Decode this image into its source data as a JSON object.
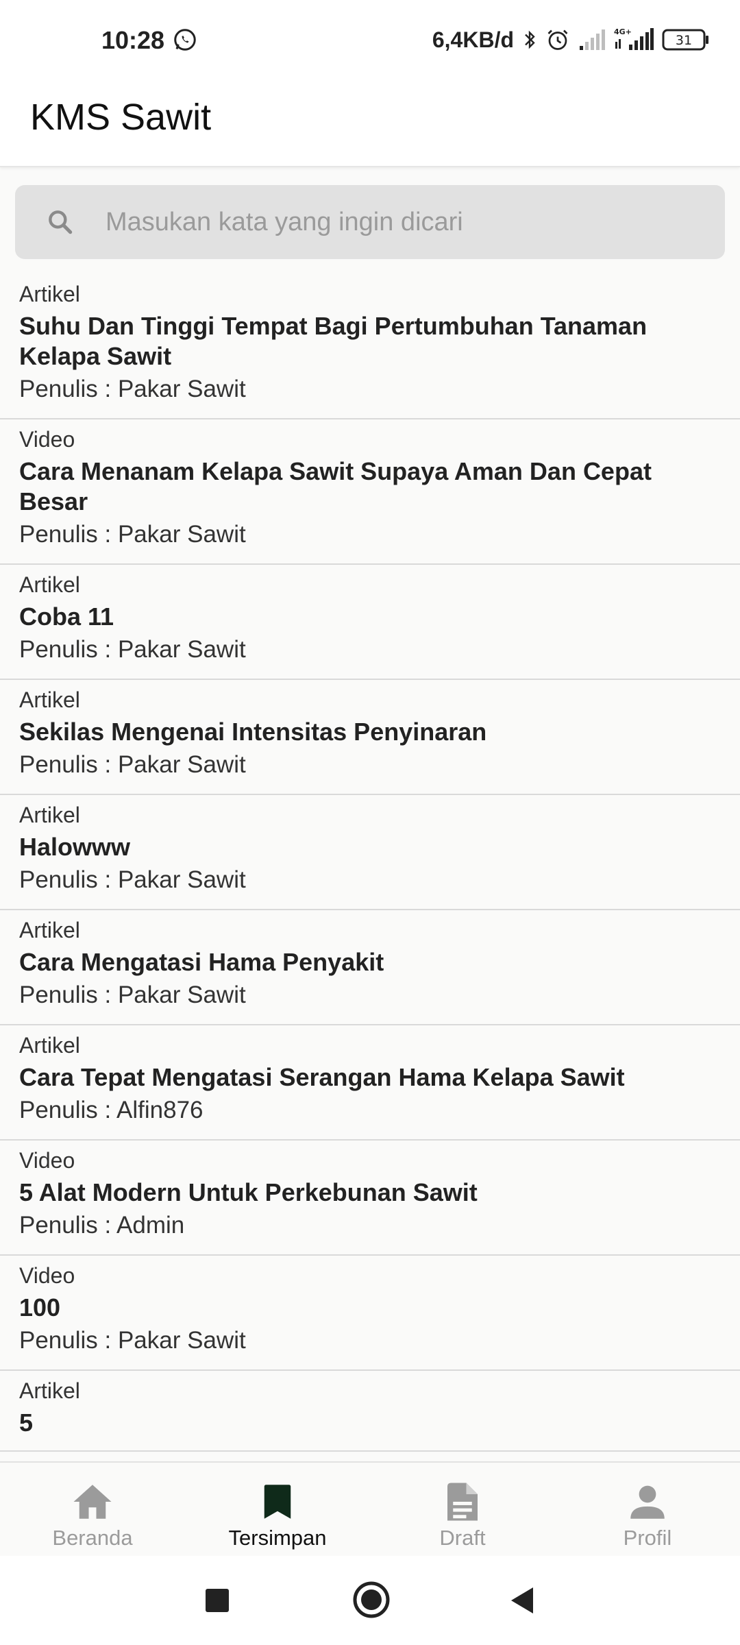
{
  "status_bar": {
    "time": "10:28",
    "network_speed": "6,4KB/d",
    "battery": "31",
    "network_type": "4G+"
  },
  "app_bar": {
    "title": "KMS Sawit"
  },
  "search": {
    "placeholder": "Masukan kata yang ingin dicari",
    "value": ""
  },
  "list": {
    "items": [
      {
        "type": "Artikel",
        "title": "Suhu Dan Tinggi Tempat Bagi Pertumbuhan Tanaman Kelapa Sawit",
        "author": "Penulis : Pakar Sawit"
      },
      {
        "type": "Video",
        "title": "Cara Menanam Kelapa Sawit Supaya Aman Dan Cepat Besar",
        "author": "Penulis : Pakar Sawit"
      },
      {
        "type": "Artikel",
        "title": "Coba 11",
        "author": "Penulis : Pakar Sawit"
      },
      {
        "type": "Artikel",
        "title": "Sekilas Mengenai Intensitas Penyinaran",
        "author": "Penulis : Pakar Sawit"
      },
      {
        "type": "Artikel",
        "title": "Halowww",
        "author": "Penulis : Pakar Sawit"
      },
      {
        "type": "Artikel",
        "title": "Cara Mengatasi Hama Penyakit",
        "author": "Penulis : Pakar Sawit"
      },
      {
        "type": "Artikel",
        "title": "Cara Tepat Mengatasi Serangan Hama Kelapa Sawit",
        "author": "Penulis : Alfin876"
      },
      {
        "type": "Video",
        "title": "5 Alat Modern Untuk Perkebunan Sawit",
        "author": "Penulis : Admin"
      },
      {
        "type": "Video",
        "title": "100",
        "author": "Penulis : Pakar Sawit"
      },
      {
        "type": "Artikel",
        "title": "5",
        "author": ""
      }
    ]
  },
  "bottom_nav": {
    "items": [
      {
        "label": "Beranda",
        "icon": "home-icon",
        "active": false
      },
      {
        "label": "Tersimpan",
        "icon": "bookmark-icon",
        "active": true
      },
      {
        "label": "Draft",
        "icon": "document-icon",
        "active": false
      },
      {
        "label": "Profil",
        "icon": "person-icon",
        "active": false
      }
    ]
  },
  "colors": {
    "inactive_nav": "#9b9b9b",
    "active_nav": "#111111",
    "active_bookmark": "#0f2a1a",
    "search_bg": "#e1e1e1",
    "divider": "#d9d9d9"
  }
}
